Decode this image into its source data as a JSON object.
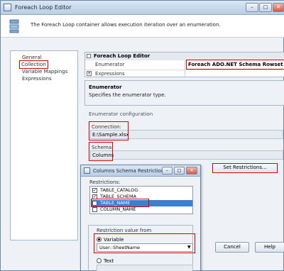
{
  "window": {
    "title": "Foreach Loop Editor",
    "controls": {
      "minimize": "–",
      "maximize": "□",
      "close": "✕"
    }
  },
  "header": {
    "description": "The Foreach Loop container allows execution iteration over an enumeration."
  },
  "nav": {
    "items": [
      "General",
      "Collection",
      "Variable Mappings",
      "Expressions"
    ],
    "selected": "Collection"
  },
  "property_grid": {
    "category": "Foreach Loop Editor",
    "enumerator_label": "Enumerator",
    "enumerator_value": "Foreach ADO.NET Schema Rowset Enumerator",
    "expressions_label": "Expressions",
    "expand_symbol": "+"
  },
  "description_panel": {
    "title": "Enumerator",
    "text": "Specifies the enumerator type."
  },
  "enumerator_config": {
    "section_label": "Enumerator configuration",
    "connection_label": "Connection:",
    "connection_value": "E:\\Sample.xlsx",
    "schema_label": "Schema:",
    "schema_value": "Columns",
    "set_restrictions_label": "Set Restrictions..."
  },
  "buttons": {
    "cancel": "Cancel",
    "help": "Help"
  },
  "dialog": {
    "title": "Columns Schema Restrictions",
    "controls": {
      "minimize": "–",
      "maximize": "□",
      "close": "✕"
    },
    "restrictions_label": "Restrictions:",
    "restrictions": [
      {
        "name": "TABLE_CATALOG",
        "checked": true,
        "mark": "✓"
      },
      {
        "name": "TABLE_SCHEMA",
        "checked": true,
        "mark": "✓"
      },
      {
        "name": "TABLE_NAME",
        "checked": true,
        "mark": "✓",
        "selected": true
      },
      {
        "name": "COLUMN_NAME",
        "checked": false,
        "mark": ""
      }
    ],
    "restriction_value_from_label": "Restriction value from",
    "variable_label": "Variable",
    "variable_value": "User::SheetName",
    "text_label": "Text",
    "dropdown_symbol": "▼"
  },
  "colors": {
    "highlight": "#d00000",
    "selection": "#3c7fd0"
  }
}
